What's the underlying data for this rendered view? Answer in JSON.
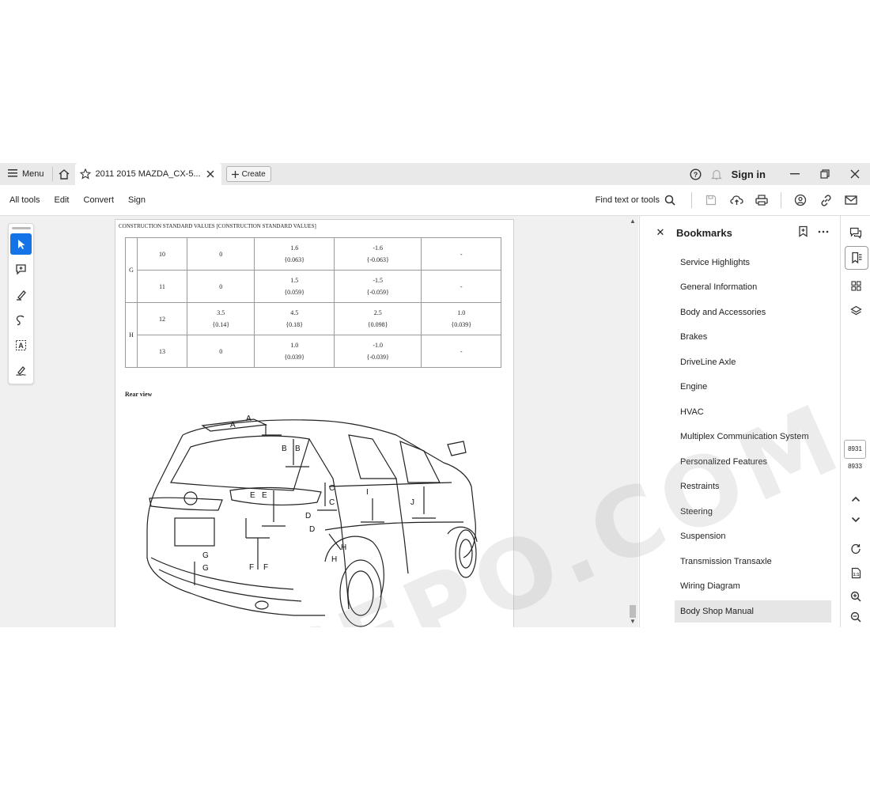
{
  "titlebar": {
    "menu_label": "Menu",
    "tab_title": "2011 2015 MAZDA_CX-5...",
    "create_label": "Create",
    "sign_in": "Sign in"
  },
  "toolbar": {
    "items": [
      "All tools",
      "Edit",
      "Convert",
      "Sign"
    ],
    "find_label": "Find text or tools"
  },
  "document": {
    "header": "CONSTRUCTION STANDARD VALUES [CONSTRUCTION STANDARD VALUES]",
    "table": {
      "rows": [
        {
          "group": "G",
          "no": "10",
          "c1": "0",
          "c2": [
            "1.6",
            "{0.063}"
          ],
          "c3": [
            "-1.6",
            "{-0.063}"
          ],
          "c4": "-"
        },
        {
          "group": "",
          "no": "11",
          "c1": "0",
          "c2": [
            "1.5",
            "{0.059}"
          ],
          "c3": [
            "-1.5",
            "{-0.059}"
          ],
          "c4": "-"
        },
        {
          "group": "H",
          "no": "12",
          "c1": [
            "3.5",
            "{0.14}"
          ],
          "c2": [
            "4.5",
            "{0.18}"
          ],
          "c3": [
            "2.5",
            "{0.098}"
          ],
          "c4": [
            "1.0",
            "{0.039}"
          ]
        },
        {
          "group": "",
          "no": "13",
          "c1": "0",
          "c2": [
            "1.0",
            "{0.039}"
          ],
          "c3": [
            "-1.0",
            "{-0.039}"
          ],
          "c4": "-"
        }
      ]
    },
    "rear_view_title": "Rear view",
    "callouts": {
      "A": "A",
      "B": "B",
      "C": "C",
      "D": "D",
      "E": "E",
      "F": "F",
      "G": "G",
      "H": "H",
      "I": "I",
      "J": "J"
    }
  },
  "bookmarks": {
    "title": "Bookmarks",
    "items": [
      "Service Highlights",
      "General Information",
      "Body and Accessories",
      "Brakes",
      "DriveLine Axle",
      "Engine",
      "HVAC",
      "Multiplex Communication System",
      "Personalized Features",
      "Restraints",
      "Steering",
      "Suspension",
      "Transmission Transaxle",
      "Wiring Diagram",
      "Body Shop Manual"
    ],
    "selected": "Body Shop Manual"
  },
  "rail": {
    "current_page": "8931",
    "total_pages": "8933"
  },
  "watermark": "EPCEPO.COM",
  "colors": {
    "accent": "#1473e6",
    "titlebar_bg": "#e9e9e9",
    "selected_bg": "#e6e6e6"
  }
}
